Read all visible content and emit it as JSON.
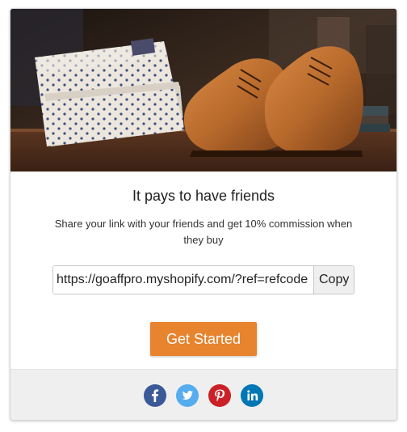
{
  "card": {
    "title": "It pays to have friends",
    "subtitle": "Share your link with your friends and get 10% commission when they buy",
    "referral_link": "https://goaffpro.myshopify.com/?ref=refcode",
    "copy_label": "Copy",
    "cta_label": "Get Started"
  },
  "hero": {
    "image": "shirts-and-leather-shoes-photo"
  },
  "social": [
    {
      "name": "facebook",
      "icon": "facebook-icon",
      "color": "#3b5998"
    },
    {
      "name": "twitter",
      "icon": "twitter-icon",
      "color": "#55acee"
    },
    {
      "name": "pinterest",
      "icon": "pinterest-icon",
      "color": "#cb2027"
    },
    {
      "name": "linkedin",
      "icon": "linkedin-icon",
      "color": "#0077b5"
    }
  ],
  "colors": {
    "accent": "#e8832e",
    "footer_bg": "#efefef"
  }
}
